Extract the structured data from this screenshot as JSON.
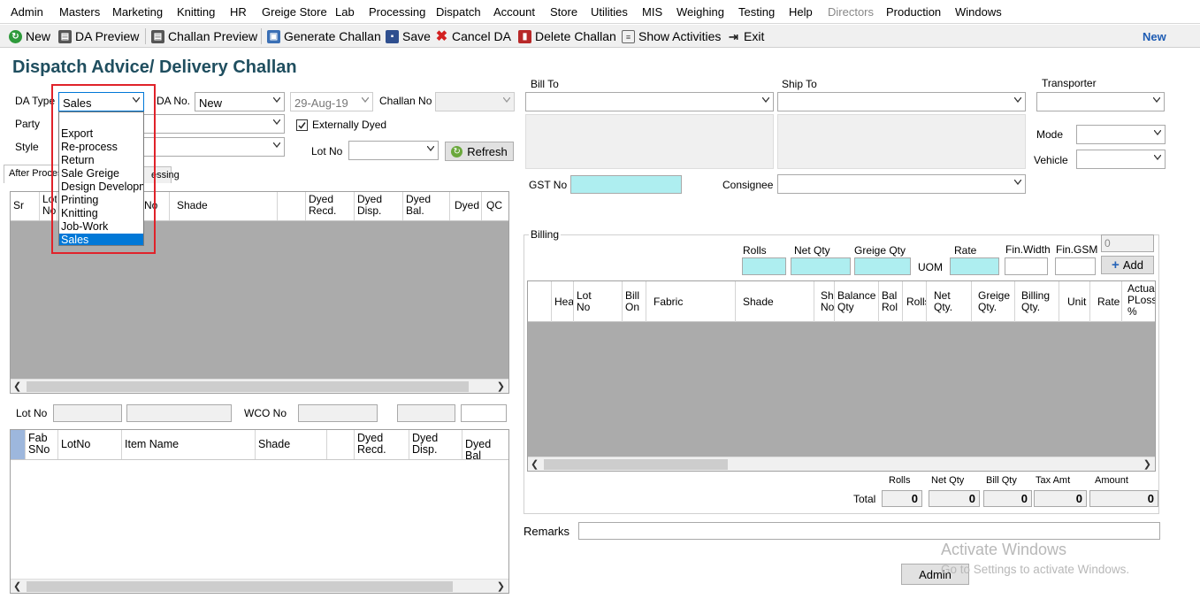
{
  "menu": [
    "Admin",
    "Masters",
    "Marketing",
    "Knitting",
    "HR",
    "Greige Store",
    "Lab",
    "Processing",
    "Dispatch",
    "Account",
    "Store",
    "Utilities",
    "MIS",
    "Weighing",
    "Testing",
    "Help",
    "Directors",
    "Production",
    "Windows"
  ],
  "toolbar": {
    "new": "New",
    "da_preview": "DA Preview",
    "challan_preview": "Challan Preview",
    "generate_challan": "Generate Challan",
    "save": "Save",
    "cancel_da": "Cancel DA",
    "delete_challan": "Delete Challan",
    "show_activities": "Show Activities",
    "exit": "Exit",
    "mode_status": "New"
  },
  "title": "Dispatch Advice/ Delivery Challan",
  "form": {
    "da_type_label": "DA Type",
    "da_type_value": "Sales",
    "da_no_label": "DA No.",
    "da_no_value": "New",
    "date_value": "29-Aug-19",
    "challan_no_label": "Challan No",
    "party_label": "Party",
    "style_label": "Style",
    "externally_dyed_label": "Externally Dyed",
    "externally_dyed_checked": true,
    "lot_no_label": "Lot No",
    "refresh_label": "Refresh"
  },
  "da_type_options": [
    "Export",
    "Re-process",
    "Return",
    "Sale Greige",
    "Design Developm",
    "Printing",
    "Knitting",
    "Job-Work",
    "Sales"
  ],
  "da_type_selected": "Sales",
  "tabs": {
    "tab1": "After Proces",
    "tab2": "essing"
  },
  "grid1": {
    "columns": [
      "Sr",
      "Lot\nNo.",
      "No",
      "Shade",
      "",
      "Dyed\nRecd.",
      "Dyed\nDisp.",
      "Dyed\nBal.",
      "Dyed",
      "QC"
    ]
  },
  "lower_filters": {
    "lot_no_label": "Lot No",
    "wco_no_label": "WCO No"
  },
  "grid2": {
    "columns": [
      "",
      "Fab\nSNo",
      "LotNo",
      "Item Name",
      "Shade",
      "",
      "Dyed\nRecd.",
      "Dyed\nDisp.",
      "Dyed Bal"
    ]
  },
  "right_panel": {
    "bill_to_label": "Bill To",
    "ship_to_label": "Ship To",
    "transporter_label": "Transporter",
    "mode_label": "Mode",
    "vehicle_label": "Vehicle",
    "gst_no_label": "GST No",
    "consignee_label": "Consignee"
  },
  "billing": {
    "group_label": "Billing",
    "rolls_label": "Rolls",
    "net_qty_label": "Net Qty",
    "greige_qty_label": "Greige Qty",
    "uom_label": "UOM",
    "rate_label": "Rate",
    "fin_width_label": "Fin.Width",
    "fin_gsm_label": "Fin.GSM",
    "counter_value": "0",
    "add_label": "Add",
    "columns": [
      "",
      "Hea",
      "Lot\nNo",
      "Bill\nOn",
      "Fabric",
      "Shade",
      "Sh\nNo",
      "Balance\nQty",
      "Bal\nRol",
      "Rolls",
      "Net\nQty.",
      "Greige\nQty.",
      "Billing\nQty.",
      "Unit",
      "Rate",
      "Actual\nPLoss\n%"
    ]
  },
  "totals": {
    "total_label": "Total",
    "rolls_label": "Rolls",
    "net_qty_label": "Net Qty",
    "bill_qty_label": "Bill Qty",
    "tax_amt_label": "Tax Amt",
    "amount_label": "Amount",
    "rolls": "0",
    "net_qty": "0",
    "bill_qty": "0",
    "tax_amt": "0",
    "amount": "0"
  },
  "remarks_label": "Remarks",
  "user_button": "Admin",
  "watermark": {
    "line1": "Activate Windows",
    "line2": "Go to Settings to activate Windows."
  },
  "colors": {
    "accent_title": "#1f4e5f",
    "highlight_frame": "#e0222a",
    "selection": "#0078d7",
    "input_cyan": "#aeeef0",
    "grid_fill": "#ababab"
  }
}
